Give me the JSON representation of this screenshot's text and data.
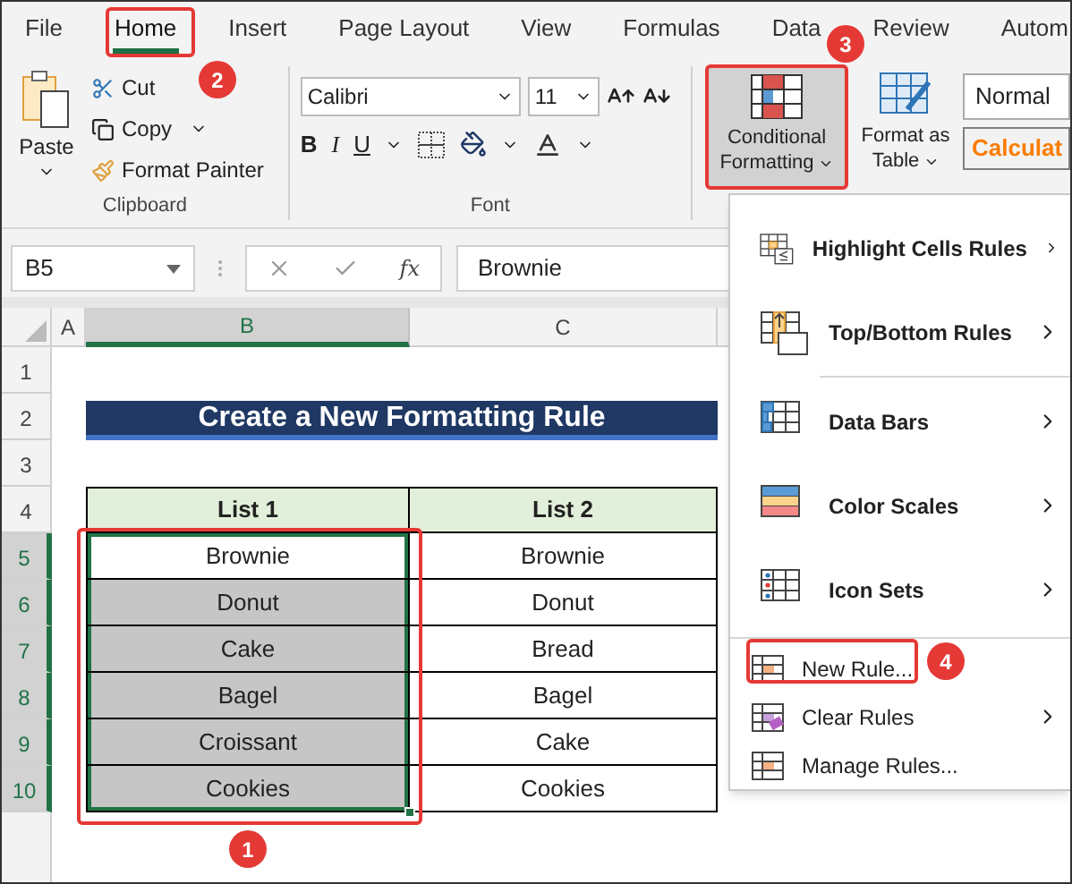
{
  "menu_tabs": [
    {
      "label": "File",
      "selected": false
    },
    {
      "label": "Home",
      "selected": true
    },
    {
      "label": "Insert",
      "selected": false
    },
    {
      "label": "Page Layout",
      "selected": false
    },
    {
      "label": "View",
      "selected": false
    },
    {
      "label": "Formulas",
      "selected": false
    },
    {
      "label": "Data",
      "selected": false
    },
    {
      "label": "Review",
      "selected": false
    },
    {
      "label": "Autom",
      "selected": false
    }
  ],
  "clipboard": {
    "paste": "Paste",
    "cut": "Cut",
    "copy": "Copy",
    "format_painter": "Format Painter",
    "group_label": "Clipboard"
  },
  "font": {
    "name": "Calibri",
    "size": "11",
    "bold": "B",
    "italic": "I",
    "underline": "U",
    "group_label": "Font"
  },
  "styles": {
    "conditional_formatting": {
      "lines": [
        "Conditional",
        "Formatting"
      ],
      "expanded": true
    },
    "format_as_table": [
      "Format as",
      "Table"
    ],
    "cell_styles": [
      "Normal",
      "Calculat"
    ]
  },
  "formula_bar": {
    "name_box": "B5",
    "fx": "fx",
    "value": "Brownie"
  },
  "column_headers": [
    {
      "label": "A",
      "selected": false
    },
    {
      "label": "B",
      "selected": true
    },
    {
      "label": "C",
      "selected": false
    }
  ],
  "row_headers": [
    {
      "label": "1",
      "selected": false
    },
    {
      "label": "2",
      "selected": false
    },
    {
      "label": "3",
      "selected": false
    },
    {
      "label": "4",
      "selected": false
    },
    {
      "label": "5",
      "selected": true
    },
    {
      "label": "6",
      "selected": true
    },
    {
      "label": "7",
      "selected": true
    },
    {
      "label": "8",
      "selected": true
    },
    {
      "label": "9",
      "selected": true
    },
    {
      "label": "10",
      "selected": true
    }
  ],
  "sheet": {
    "title": "Create a New Formatting Rule",
    "columns": [
      "List 1",
      "List 2"
    ],
    "rows": [
      {
        "cells": [
          "Brownie",
          "Brownie"
        ],
        "selected": true,
        "active": true
      },
      {
        "cells": [
          "Donut",
          "Donut"
        ],
        "selected": true,
        "active": false
      },
      {
        "cells": [
          "Cake",
          "Bread"
        ],
        "selected": true,
        "active": false
      },
      {
        "cells": [
          "Bagel",
          "Bagel"
        ],
        "selected": true,
        "active": false
      },
      {
        "cells": [
          "Croissant",
          "Cake"
        ],
        "selected": true,
        "active": false
      },
      {
        "cells": [
          "Cookies",
          "Cookies"
        ],
        "selected": true,
        "active": false
      }
    ]
  },
  "menu": {
    "items": [
      {
        "label": "Highlight Cells Rules",
        "kind": "large",
        "submenu": true
      },
      {
        "label": "Top/Bottom Rules",
        "kind": "large",
        "submenu": true
      },
      {
        "label": "Data Bars",
        "kind": "large",
        "submenu": true
      },
      {
        "label": "Color Scales",
        "kind": "large",
        "submenu": true
      },
      {
        "label": "Icon Sets",
        "kind": "large",
        "submenu": true
      },
      {
        "label": "New Rule...",
        "kind": "small",
        "submenu": false
      },
      {
        "label": "Clear Rules",
        "kind": "small",
        "submenu": true
      },
      {
        "label": "Manage Rules...",
        "kind": "small",
        "submenu": false
      }
    ]
  },
  "callouts": [
    "1",
    "2",
    "3",
    "4"
  ]
}
